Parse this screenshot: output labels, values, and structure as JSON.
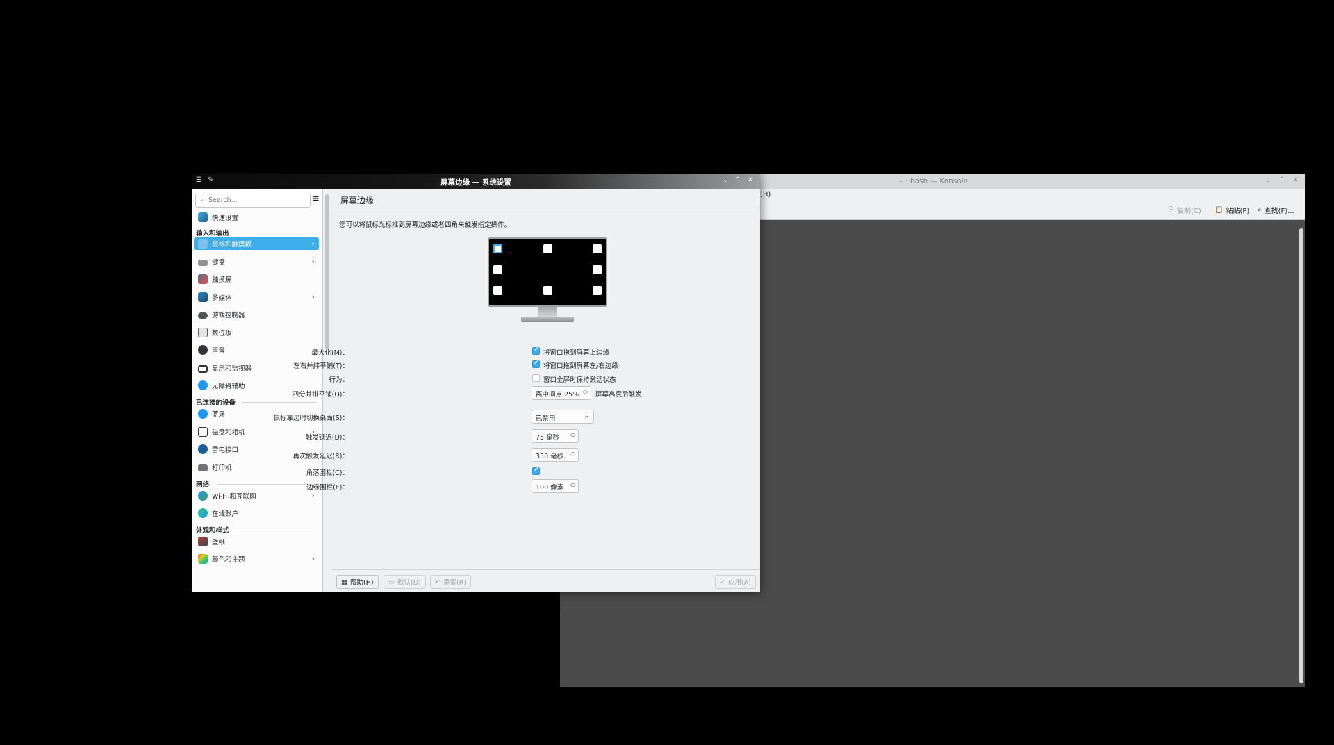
{
  "konsole": {
    "title": "~ : bash — Konsole",
    "menu_visible": "(H)",
    "toolbar": {
      "copy": "复制(C)",
      "paste": "粘贴(P)",
      "find": "查找(F)..."
    }
  },
  "settings": {
    "title": "屏幕边缘 — 系统设置",
    "search_placeholder": "Search...",
    "sidebar": {
      "quick": "快速设置",
      "cat_io": "输入和输出",
      "mouse": "鼠标和触摸板",
      "keyboard": "键盘",
      "touchscreen": "触摸屏",
      "multimedia": "多媒体",
      "game": "游戏控制器",
      "tablet": "数位板",
      "sound": "声音",
      "display": "显示和监视器",
      "accessibility": "无障碍辅助",
      "cat_devices": "已连接的设备",
      "bluetooth": "蓝牙",
      "disks": "磁盘和相机",
      "thunderbolt": "雷电接口",
      "printers": "打印机",
      "cat_network": "网络",
      "wifi": "Wi-Fi 和互联网",
      "online": "在线账户",
      "cat_appearance": "外观和样式",
      "wallpaper": "壁纸",
      "colors": "颜色和主题"
    },
    "page": {
      "heading": "屏幕边缘",
      "description": "您可以将鼠标光标推到屏幕边缘或者四角来触发指定操作。",
      "maximize_label": "最大化(M)：",
      "maximize_text": "将窗口拖到屏幕上边缘",
      "tile_label": "左右并排平铺(T)：",
      "tile_text": "将窗口拖到屏幕左/右边缘",
      "behavior_label": "行为：",
      "behavior_text": "窗口全屏时保持激活状态",
      "quarter_label": "四分并排平铺(Q)：",
      "quarter_value": "离中间点 25%",
      "quarter_after": "屏幕高度后触发",
      "switch_label": "鼠标靠边时切换桌面(S)：",
      "switch_value": "已禁用",
      "delay_label": "触发延迟(D)：",
      "delay_value": "75 毫秒",
      "retrigger_label": "再次触发延迟(R)：",
      "retrigger_value": "350 毫秒",
      "corner_label": "角落围栏(C)：",
      "edge_label": "边缘围栏(E)：",
      "edge_value": "100 像素"
    },
    "footer": {
      "help": "帮助(H)",
      "defaults": "默认(D)",
      "reset": "重置(R)",
      "apply": "应用(A)"
    }
  },
  "colors": {
    "accent": "#3daee9"
  }
}
